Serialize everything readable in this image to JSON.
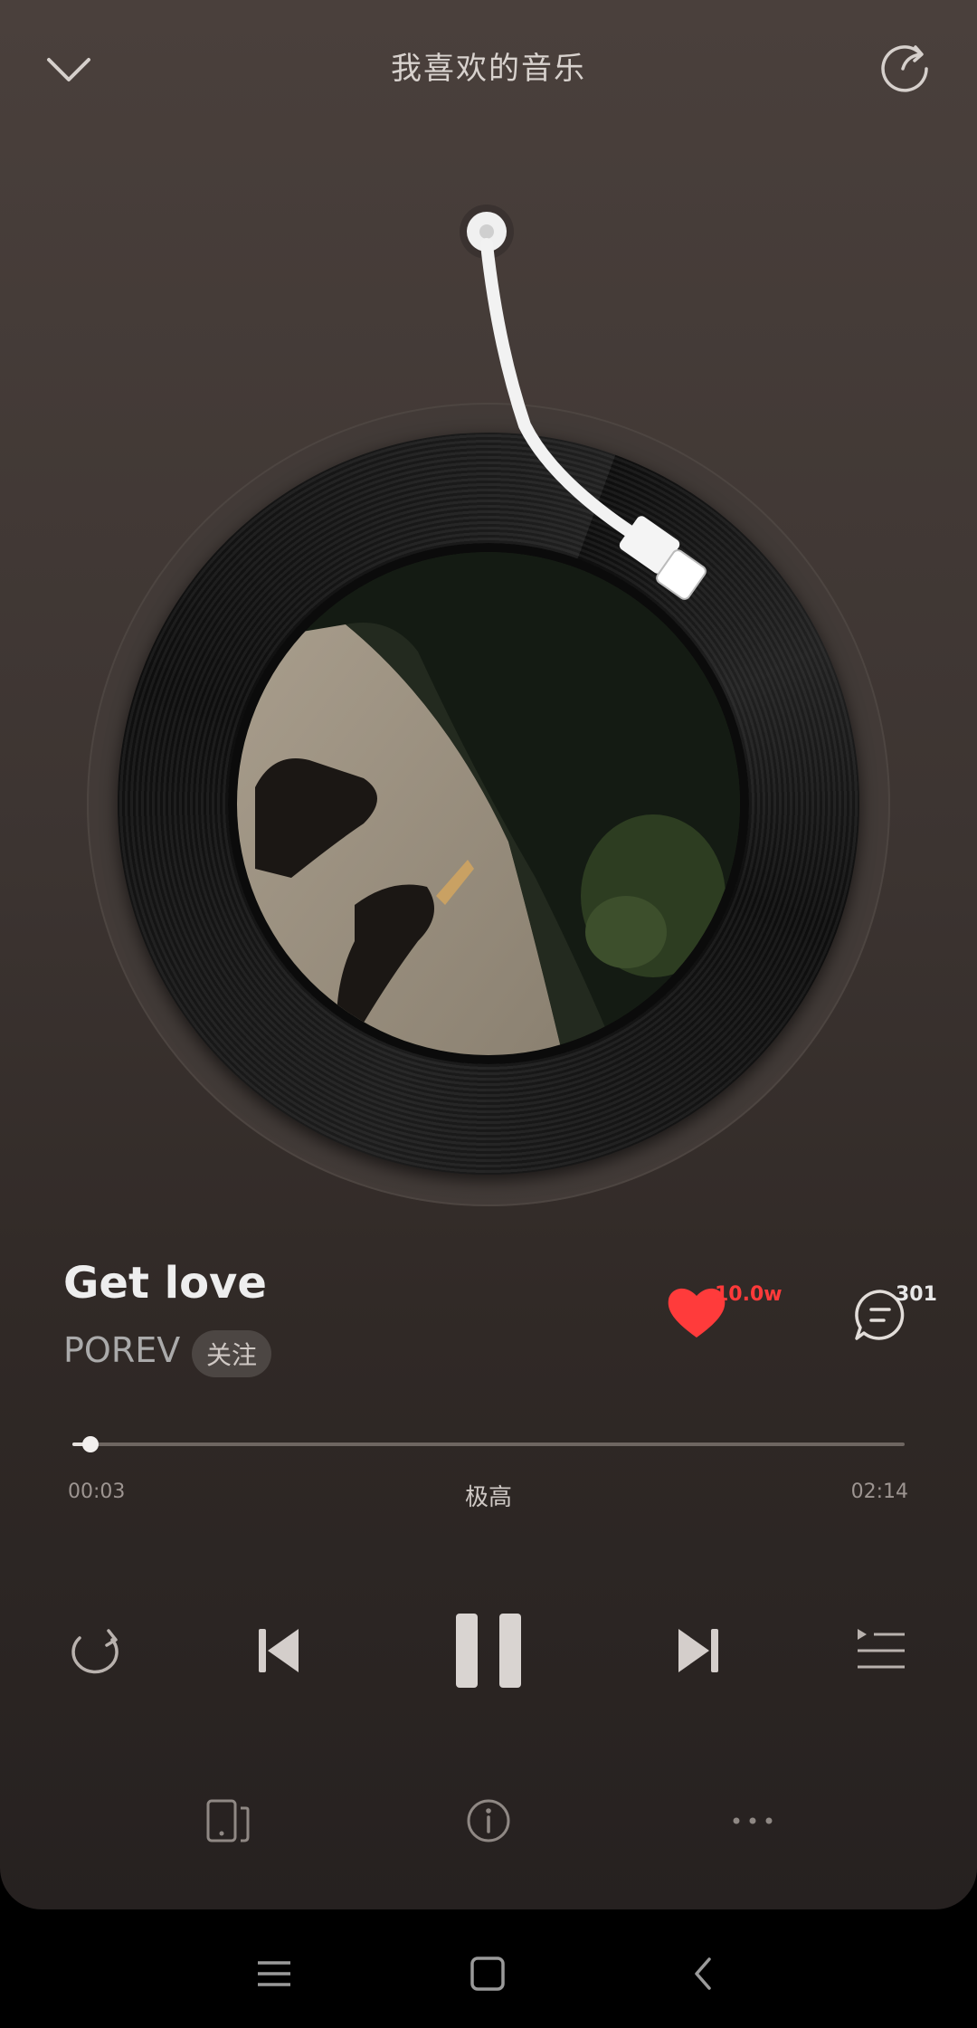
{
  "header": {
    "title": "我喜欢的音乐",
    "collapse_icon": "chevron-down-icon",
    "share_icon": "share-refresh-icon"
  },
  "player": {
    "song_title": "Get love",
    "artist": "POREV",
    "follow_label": "关注",
    "like_count": "10.0w",
    "comment_count": "301",
    "liked": true
  },
  "progress": {
    "current_time": "00:03",
    "total_time": "02:14",
    "quality": "极高",
    "fraction": 0.022
  },
  "controls": {
    "repeat_icon": "repeat-icon",
    "prev_icon": "previous-icon",
    "play_state": "playing",
    "next_icon": "next-icon",
    "playlist_icon": "playlist-icon"
  },
  "bottom_actions": [
    "device-icon",
    "info-icon",
    "more-icon"
  ],
  "system_nav": [
    "menu-icon",
    "home-icon",
    "back-icon"
  ],
  "colors": {
    "accent": "#ff3a3a",
    "panel_top": "#4a403c",
    "panel_bottom": "#262120"
  }
}
